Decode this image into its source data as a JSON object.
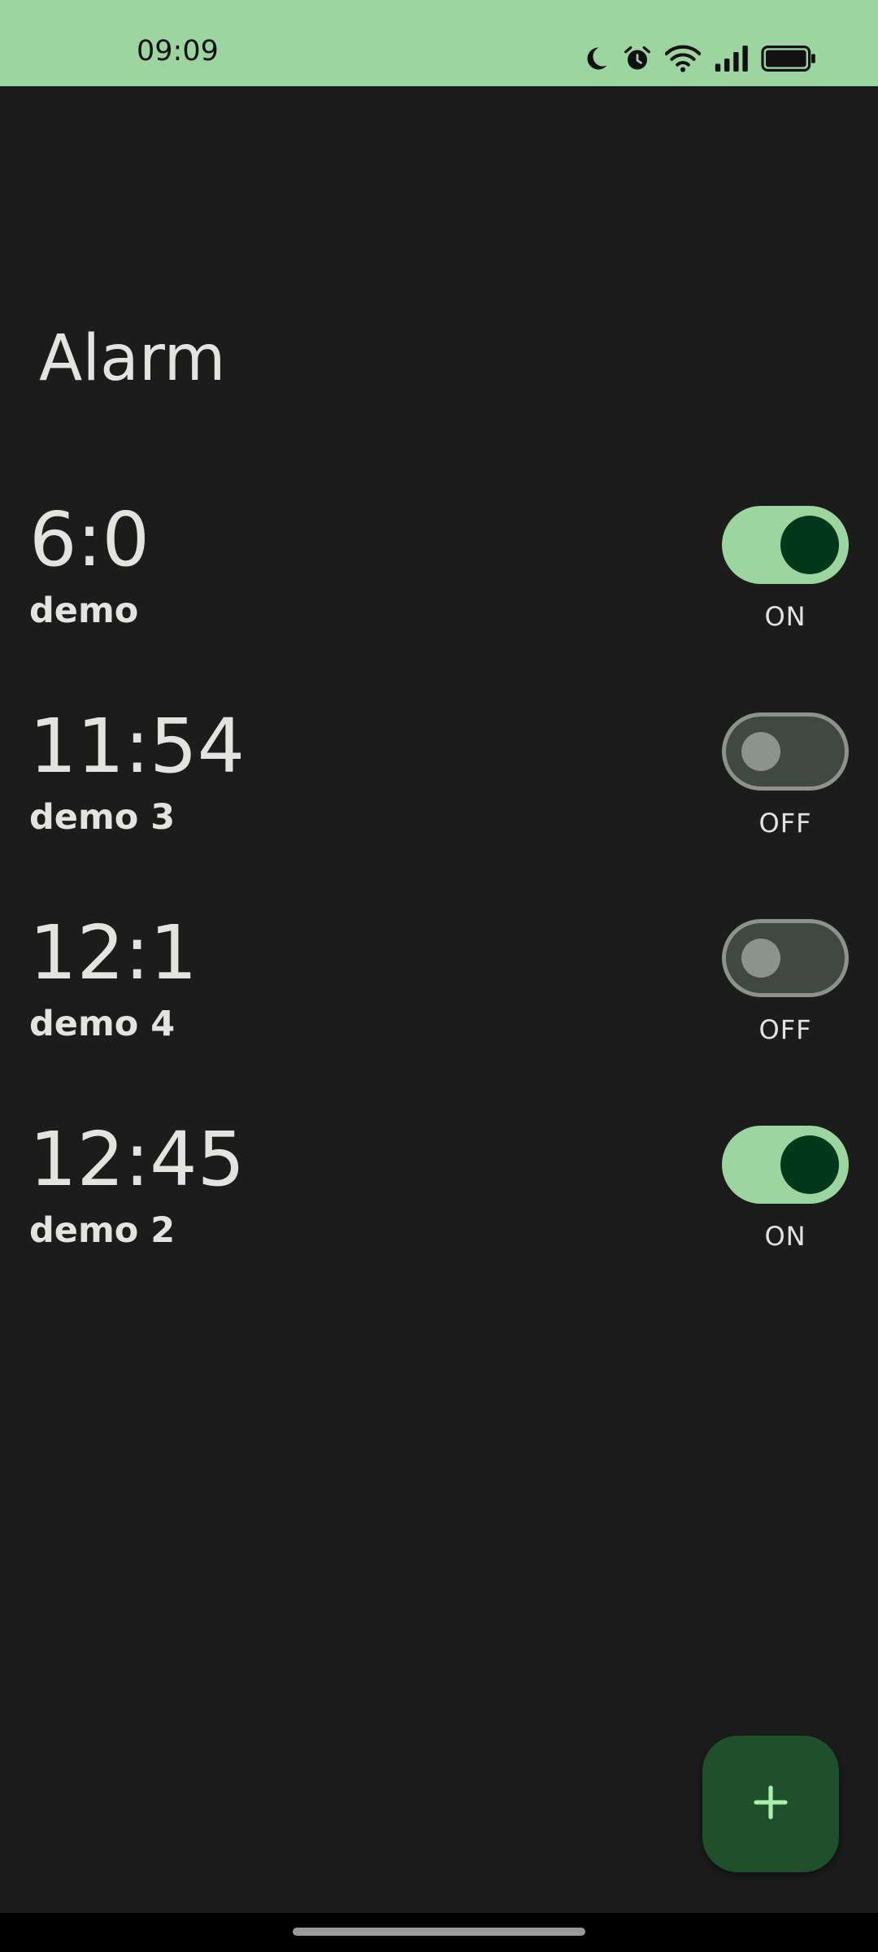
{
  "status_bar": {
    "time": "09:09",
    "icons": [
      "moon-icon",
      "alarm-clock-icon",
      "wifi-icon",
      "signal-icon",
      "battery-icon"
    ]
  },
  "page": {
    "title": "Alarm"
  },
  "alarms": [
    {
      "time": "6:0",
      "label": "demo",
      "state_label": "ON",
      "enabled": true
    },
    {
      "time": "11:54",
      "label": "demo 3",
      "state_label": "OFF",
      "enabled": false
    },
    {
      "time": "12:1",
      "label": "demo 4",
      "state_label": "OFF",
      "enabled": false
    },
    {
      "time": "12:45",
      "label": "demo 2",
      "state_label": "ON",
      "enabled": true
    }
  ],
  "fab": {
    "icon": "plus-icon"
  },
  "colors": {
    "background": "#1b1c1b",
    "status_bar": "#9cd59f",
    "switch_on_track": "#9cd59f",
    "switch_on_thumb": "#00391a",
    "switch_off_track": "#414842",
    "switch_off_outline": "#8c928c",
    "fab": "#1f502b",
    "fab_icon": "#a8f0ab",
    "text": "#e3e3e0"
  }
}
